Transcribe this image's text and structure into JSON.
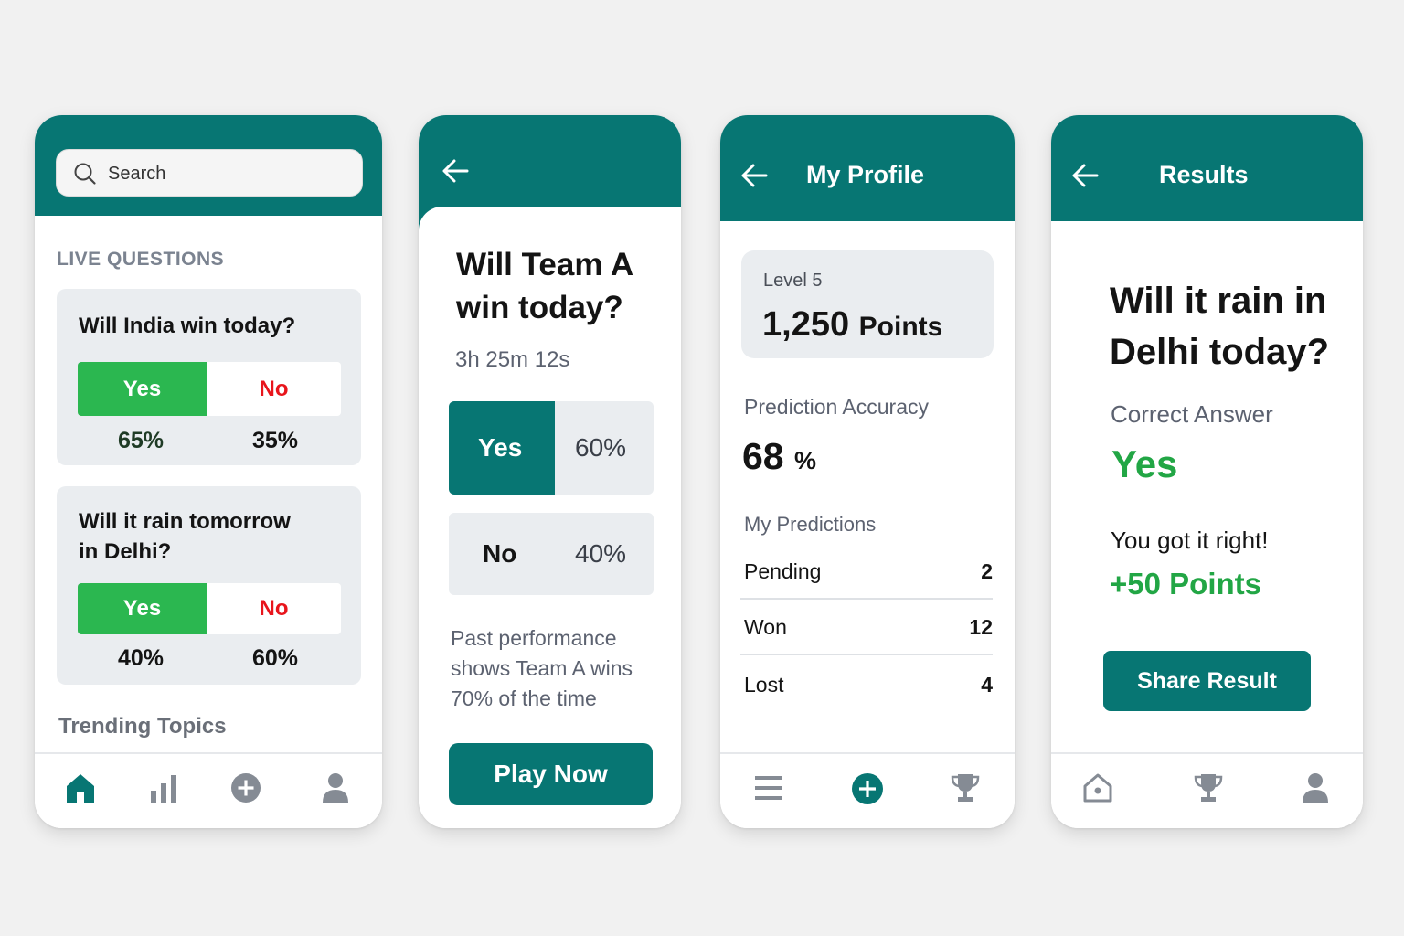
{
  "colors": {
    "teal": "#077673",
    "green": "#2bb750",
    "red": "#e8151c",
    "background": "#f1f1f1"
  },
  "home": {
    "search_placeholder": "Search",
    "section_label": "LIVE QUESTIONS",
    "questions": [
      {
        "title": "Will India win today?",
        "yes_label": "Yes",
        "no_label": "No",
        "yes_pct": "65%",
        "no_pct": "35%"
      },
      {
        "title_line1": "Will it rain tomorrow",
        "title_line2": "in Delhi?",
        "yes_label": "Yes",
        "no_label": "No",
        "yes_pct": "40%",
        "no_pct": "60%"
      }
    ],
    "trending_label": "Trending Topics",
    "nav_icons": [
      "home-icon",
      "bar-chart-icon",
      "plus-circle-icon",
      "user-icon"
    ]
  },
  "question_detail": {
    "title_line1": "Will Team A",
    "title_line2": "win today?",
    "timer": "3h 25m 12s",
    "options": [
      {
        "label": "Yes",
        "pct": "60%",
        "selected": true
      },
      {
        "label": "No",
        "pct": "40%",
        "selected": false
      }
    ],
    "past_line1": "Past performance",
    "past_line2": "shows Team A wins",
    "past_line3": "70% of the time",
    "play_button": "Play Now"
  },
  "profile": {
    "title": "My Profile",
    "level": "Level 5",
    "points_value": "1,250",
    "points_word": "Points",
    "accuracy_label": "Prediction Accuracy",
    "accuracy_value": "68",
    "accuracy_unit": "%",
    "predictions_label": "My Predictions",
    "predictions": [
      {
        "label": "Pending",
        "value": "2"
      },
      {
        "label": "Won",
        "value": "12"
      },
      {
        "label": "Lost",
        "value": "4"
      }
    ],
    "nav_icons": [
      "menu-icon",
      "plus-circle-icon",
      "trophy-icon"
    ]
  },
  "results": {
    "title": "Results",
    "question_line1": "Will it rain in",
    "question_line2": "Delhi today?",
    "correct_label": "Correct Answer",
    "correct_value": "Yes",
    "outcome": "You got it right!",
    "points": "+50 Points",
    "share_button": "Share Result",
    "nav_icons": [
      "home-icon",
      "trophy-icon",
      "user-icon"
    ]
  }
}
